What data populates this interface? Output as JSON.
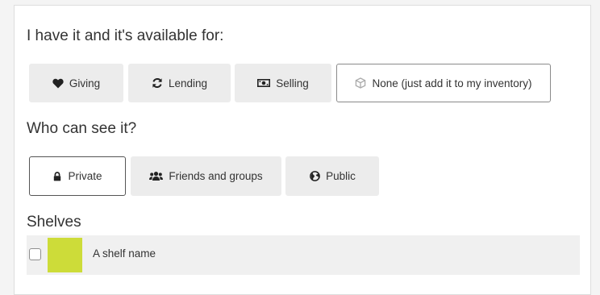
{
  "availability": {
    "heading": "I have it and it's available for:",
    "options": [
      {
        "label": "Giving",
        "icon": "heart-icon",
        "selected": false
      },
      {
        "label": "Lending",
        "icon": "refresh-icon",
        "selected": false
      },
      {
        "label": "Selling",
        "icon": "money-icon",
        "selected": false
      },
      {
        "label": "None (just add it to my inventory)",
        "icon": "cube-icon",
        "selected": true
      }
    ]
  },
  "visibility": {
    "heading": "Who can see it?",
    "options": [
      {
        "label": "Private",
        "icon": "lock-icon",
        "selected": true
      },
      {
        "label": "Friends and groups",
        "icon": "users-icon",
        "selected": false
      },
      {
        "label": "Public",
        "icon": "globe-icon",
        "selected": false
      }
    ]
  },
  "shelves": {
    "heading": "Shelves",
    "items": [
      {
        "name": "A shelf name",
        "color": "#cddc39",
        "checked": false
      }
    ]
  },
  "colors": {
    "panel_bg": "#ffffff",
    "button_bg": "#ececec",
    "selected_border": "#555555",
    "shelf_row_bg": "#f0f0f0"
  }
}
